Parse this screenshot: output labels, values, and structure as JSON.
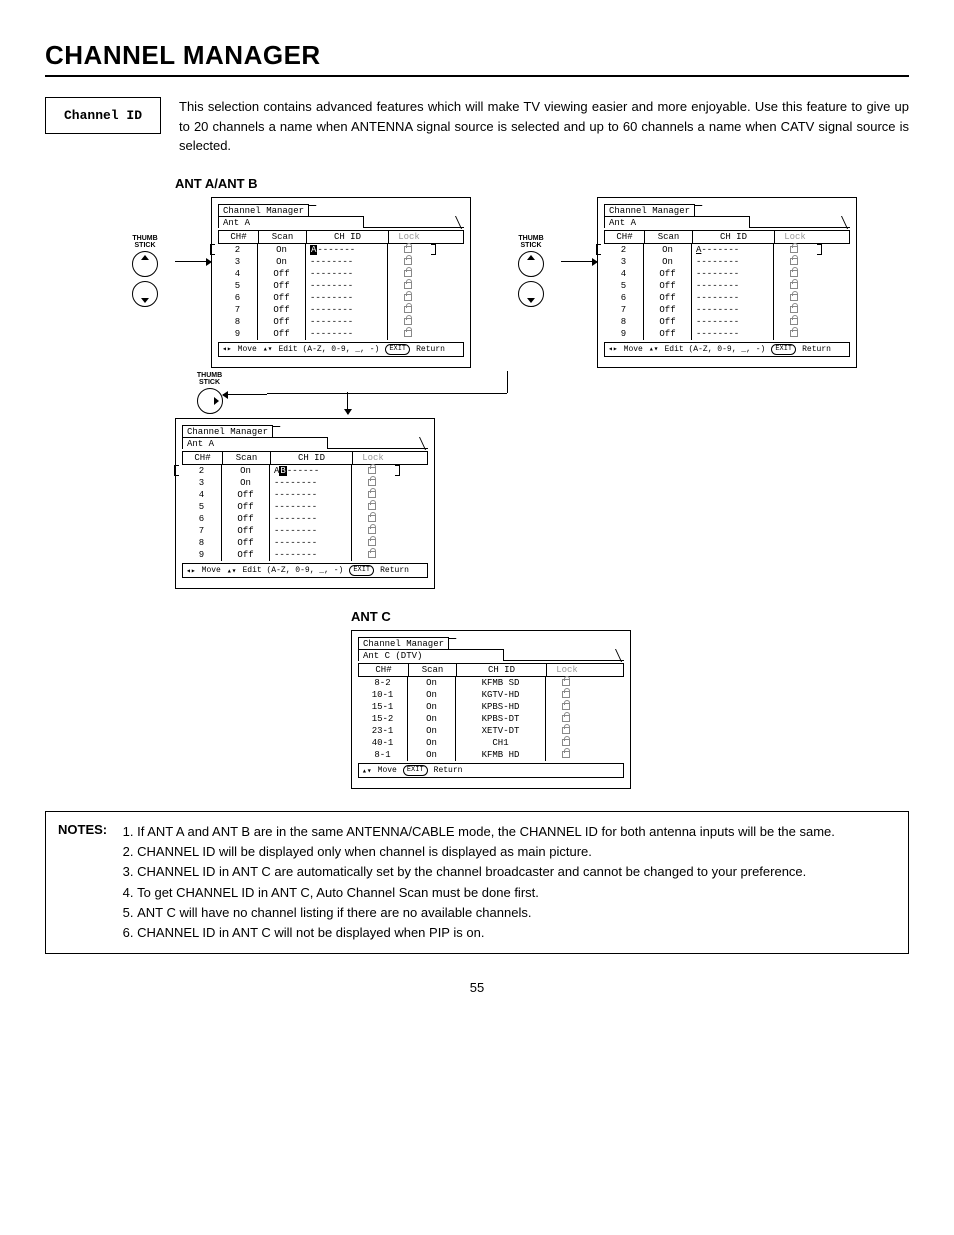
{
  "page_title": "CHANNEL MANAGER",
  "channel_id_label": "Channel ID",
  "intro_text": "This selection contains advanced features which will make TV viewing easier and more enjoyable.  Use this feature to give up to 20 channels a name when ANTENNA signal source is selected and up to 60 channels a name when CATV signal source is selected.",
  "section_ab": "ANT A/ANT B",
  "section_c": "ANT C",
  "thumb_label": "THUMB\nSTICK",
  "osd": {
    "title": "Channel Manager",
    "subtab": "Ant A",
    "subtab_dtv": "Ant C (DTV)",
    "headers": {
      "ch": "CH#",
      "scan": "Scan",
      "chid": "CH ID",
      "lock": "Lock"
    },
    "foot_move": "Move",
    "foot_edit": "Edit (A-Z, 0-9, _, -)",
    "foot_return": "Return",
    "exit": "EXIT"
  },
  "panel1": {
    "rows": [
      {
        "ch": "2",
        "scan": "On",
        "chid": "A",
        "rest": "-------"
      },
      {
        "ch": "3",
        "scan": "On",
        "chid": "",
        "rest": "--------"
      },
      {
        "ch": "4",
        "scan": "Off",
        "chid": "",
        "rest": "--------"
      },
      {
        "ch": "5",
        "scan": "Off",
        "chid": "",
        "rest": "--------"
      },
      {
        "ch": "6",
        "scan": "Off",
        "chid": "",
        "rest": "--------"
      },
      {
        "ch": "7",
        "scan": "Off",
        "chid": "",
        "rest": "--------"
      },
      {
        "ch": "8",
        "scan": "Off",
        "chid": "",
        "rest": "--------"
      },
      {
        "ch": "9",
        "scan": "Off",
        "chid": "",
        "rest": "--------"
      }
    ],
    "cursor_style": "fill"
  },
  "panel2": {
    "rows": [
      {
        "ch": "2",
        "scan": "On",
        "chid": "A",
        "rest": "-------"
      },
      {
        "ch": "3",
        "scan": "On",
        "chid": "",
        "rest": "--------"
      },
      {
        "ch": "4",
        "scan": "Off",
        "chid": "",
        "rest": "--------"
      },
      {
        "ch": "5",
        "scan": "Off",
        "chid": "",
        "rest": "--------"
      },
      {
        "ch": "6",
        "scan": "Off",
        "chid": "",
        "rest": "--------"
      },
      {
        "ch": "7",
        "scan": "Off",
        "chid": "",
        "rest": "--------"
      },
      {
        "ch": "8",
        "scan": "Off",
        "chid": "",
        "rest": "--------"
      },
      {
        "ch": "9",
        "scan": "Off",
        "chid": "",
        "rest": "--------"
      }
    ],
    "cursor_style": "underline"
  },
  "panel3": {
    "rows": [
      {
        "ch": "2",
        "scan": "On",
        "chid": "AB",
        "rest": "------"
      },
      {
        "ch": "3",
        "scan": "On",
        "chid": "",
        "rest": "--------"
      },
      {
        "ch": "4",
        "scan": "Off",
        "chid": "",
        "rest": "--------"
      },
      {
        "ch": "5",
        "scan": "Off",
        "chid": "",
        "rest": "--------"
      },
      {
        "ch": "6",
        "scan": "Off",
        "chid": "",
        "rest": "--------"
      },
      {
        "ch": "7",
        "scan": "Off",
        "chid": "",
        "rest": "--------"
      },
      {
        "ch": "8",
        "scan": "Off",
        "chid": "",
        "rest": "--------"
      },
      {
        "ch": "9",
        "scan": "Off",
        "chid": "",
        "rest": "--------"
      }
    ],
    "cursor_style": "fill2"
  },
  "panel_dtv": {
    "rows": [
      {
        "ch": "8-2",
        "scan": "On",
        "chid": "KFMB SD"
      },
      {
        "ch": "10-1",
        "scan": "On",
        "chid": "KGTV-HD"
      },
      {
        "ch": "15-1",
        "scan": "On",
        "chid": "KPBS-HD"
      },
      {
        "ch": "15-2",
        "scan": "On",
        "chid": "KPBS-DT"
      },
      {
        "ch": "23-1",
        "scan": "On",
        "chid": "XETV-DT"
      },
      {
        "ch": "40-1",
        "scan": "On",
        "chid": "CH1"
      },
      {
        "ch": "8-1",
        "scan": "On",
        "chid": "KFMB HD"
      }
    ]
  },
  "notes_label": "NOTES:",
  "notes": [
    "If ANT A and ANT B are in the same ANTENNA/CABLE mode, the CHANNEL ID for both antenna inputs will be the same.",
    "CHANNEL ID will be displayed only when channel is displayed as main picture.",
    "CHANNEL ID in ANT C are automatically set by the channel broadcaster and cannot be changed to your preference.",
    "To get CHANNEL ID in ANT C, Auto Channel Scan must be done first.",
    "ANT C will have no channel listing if there are no available channels.",
    "CHANNEL ID in ANT C will not be displayed when PIP is on."
  ],
  "page_number": "55"
}
